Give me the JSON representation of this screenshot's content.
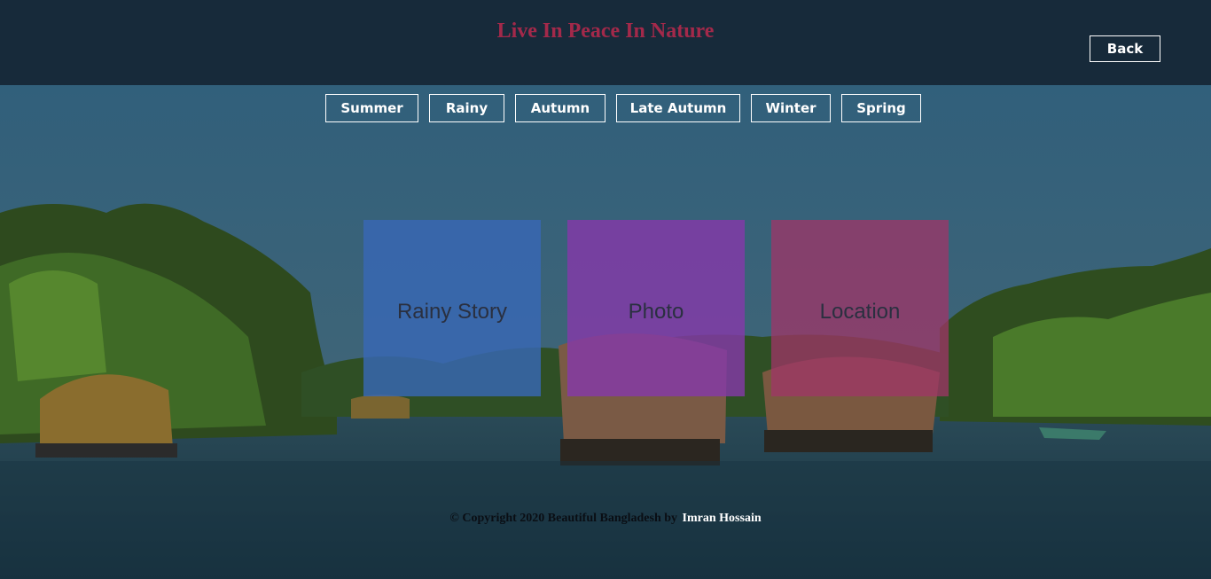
{
  "header": {
    "title": "Live In Peace In Nature",
    "back_label": "Back"
  },
  "seasons": [
    {
      "label": "Summer"
    },
    {
      "label": "Rainy"
    },
    {
      "label": "Autumn"
    },
    {
      "label": "Late Autumn"
    },
    {
      "label": "Winter"
    },
    {
      "label": "Spring"
    }
  ],
  "cards": [
    {
      "label": "Rainy Story",
      "color": "#3868b4"
    },
    {
      "label": "Photo",
      "color": "#8638aa"
    },
    {
      "label": "Location",
      "color": "#a03468"
    }
  ],
  "footer": {
    "copyright": "© Copyright 2020 Beautiful Bangladesh by",
    "author": "Imran Hossain"
  },
  "colors": {
    "header_bg": "#172a3a",
    "title": "#a3294a",
    "sky": "#2f5e7a",
    "water": "#1e3f52"
  },
  "background": {
    "description_icon": "backwater-houseboats-image"
  }
}
